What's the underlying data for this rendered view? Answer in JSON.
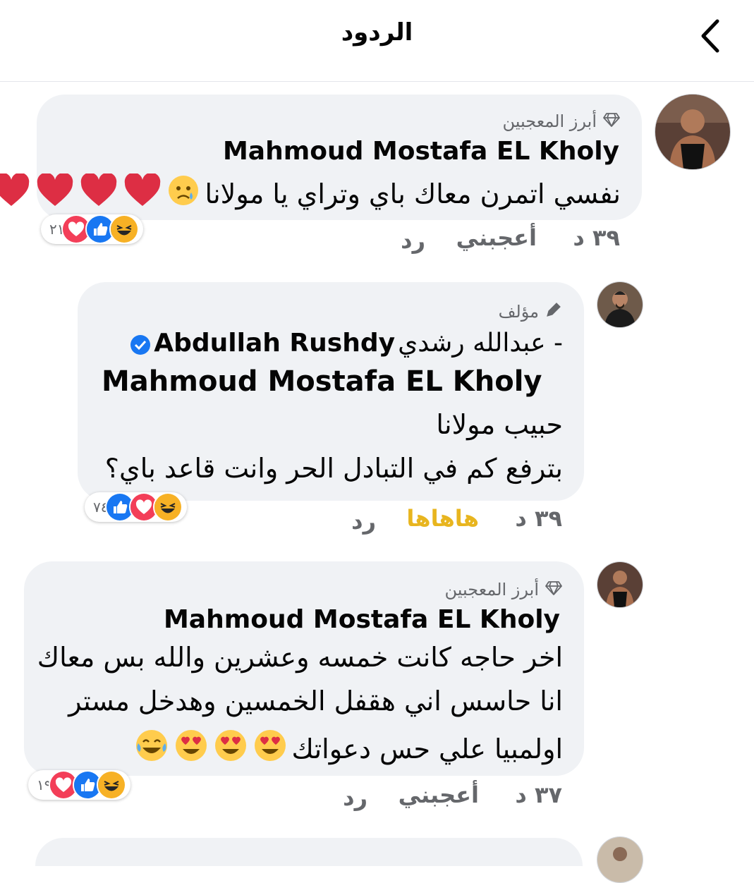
{
  "header": {
    "title": "الردود",
    "back_icon": "chevron-left-icon"
  },
  "comments": [
    {
      "label": "أبرز المعجبين",
      "label_icon": "diamond-icon",
      "author": "Mahmoud Mostafa EL Kholy",
      "text": "نفسي اتمرن معاك باي وتراي يا مولانا",
      "emojis": [
        "😥",
        "❤️",
        "❤️",
        "❤️",
        "❤️"
      ],
      "reaction_count": "٢١",
      "reactions": [
        "haha",
        "like",
        "love"
      ],
      "time": "٣٩ د",
      "like_label": "أعجبني",
      "reply_label": "رد"
    },
    {
      "label": "مؤلف",
      "label_icon": "pencil-icon",
      "author_ar": "عبدالله رشدي -",
      "author_en": "Abdullah Rushdy",
      "mention": "Mahmoud Mostafa EL Kholy",
      "lines": [
        "حبيب مولانا",
        "بترفع كم في التبادل الحر وانت قاعد باي؟"
      ],
      "reaction_count": "٧٤",
      "reactions": [
        "haha",
        "love",
        "like"
      ],
      "time": "٣٩ د",
      "like_label": "هاهاها",
      "reply_label": "رد"
    },
    {
      "label": "أبرز المعجبين",
      "label_icon": "diamond-icon",
      "author": "Mahmoud Mostafa EL Kholy",
      "lines": [
        "اخر حاجه كانت خمسه وعشرين والله بس معاك",
        "انا حاسس اني هقفل الخمسين وهدخل مستر",
        "اولمبيا علي حس دعواتك"
      ],
      "emojis": [
        "😍",
        "😍",
        "😍",
        "😂"
      ],
      "reaction_count": "١٩",
      "reactions": [
        "haha",
        "like",
        "love"
      ],
      "time": "٣٧ د",
      "like_label": "أعجبني",
      "reply_label": "رد"
    }
  ],
  "colors": {
    "like": "#1877f2",
    "love": "#f33e58",
    "haha": "#f7b125",
    "haha_text": "#e8b51f",
    "meta": "#65676b",
    "bubble": "#f0f2f5"
  }
}
